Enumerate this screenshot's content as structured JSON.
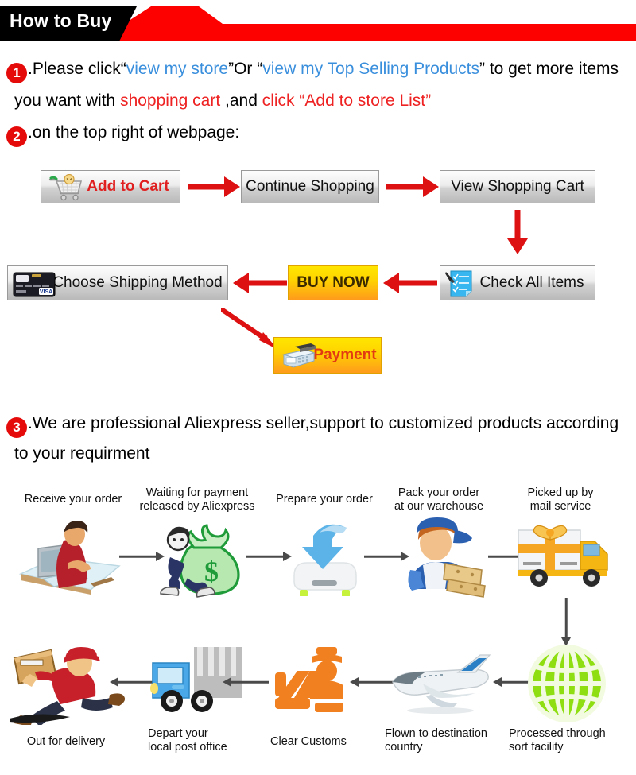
{
  "banner": {
    "title": "How to Buy",
    "red": "#fd0000",
    "black": "#000000"
  },
  "steps": {
    "one": {
      "number": "1",
      "l1_a": ".Please click",
      "l1_q1": "“",
      "l1_link1": "view my store",
      "l1_q2": "”",
      "l1_b": "Or ",
      "l1_q3": "“",
      "l1_link2": "view my Top Selling Products",
      "l1_q4": "”",
      "l1_c": " to get more items",
      "l2_a": "you want with ",
      "l2_red1": "shopping cart",
      "l2_b": " ,and ",
      "l2_red2": "click “Add to store List”"
    },
    "two": {
      "number": "2",
      "text": ".on the top right of webpage:"
    },
    "three": {
      "number": "3",
      "l1": ".We are professional Aliexpress seller,support to customized products according",
      "l2": "to your requirment"
    }
  },
  "flow": {
    "add_to_cart": "Add to Cart",
    "continue_shopping": "Continue Shopping",
    "view_shopping_cart": "View Shopping Cart",
    "choose_shipping_method": "Choose Shipping Method",
    "buy_now": "BUY NOW",
    "check_all_items": "Check All Items",
    "payment": "Payment",
    "icons": {
      "cart": "shopping-cart-icon",
      "credit_card": "credit-card-icon",
      "checklist": "checklist-icon",
      "cash_register": "cash-register-icon"
    },
    "colors": {
      "arrow": "#dd1111",
      "orange_btn": "#ffd400",
      "btn_face": "#ededed"
    }
  },
  "process": {
    "row1": [
      {
        "label": "Receive your order",
        "icon": "person-at-computer-icon"
      },
      {
        "label": "Waiting for payment\nreleased by Aliexpress",
        "icon": "money-bag-icon"
      },
      {
        "label": "Prepare your order",
        "icon": "download-arrow-icon"
      },
      {
        "label": "Pack your order\nat our warehouse",
        "icon": "warehouse-worker-icon"
      },
      {
        "label": "Picked up by\nmail service",
        "icon": "delivery-truck-gift-icon"
      }
    ],
    "row2": [
      {
        "label": "Out for delivery",
        "icon": "courier-running-icon"
      },
      {
        "label": "Depart your\nlocal post office",
        "icon": "post-truck-icon"
      },
      {
        "label": "Clear Customs",
        "icon": "customs-officer-icon"
      },
      {
        "label": "Flown to destination\ncountry",
        "icon": "airplane-icon"
      },
      {
        "label": "Processed through\nsort facility",
        "icon": "green-globe-icon"
      }
    ],
    "arrow_color": "#4a4a4a"
  }
}
